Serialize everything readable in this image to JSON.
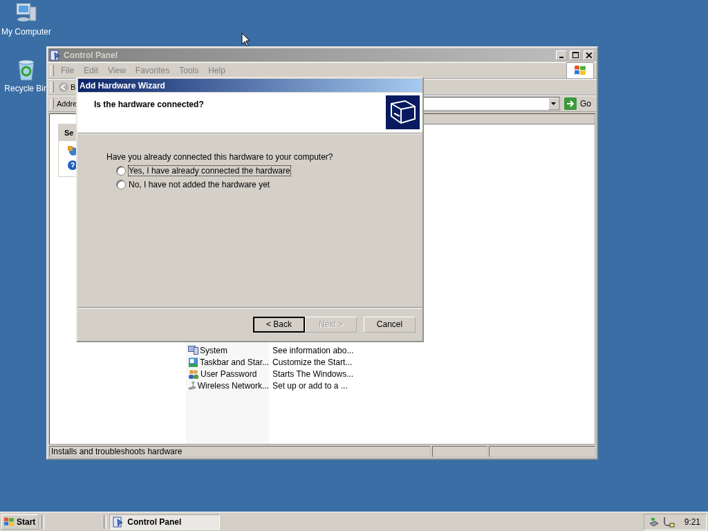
{
  "desktop_icons": [
    {
      "kind": "computer",
      "label": "My Computer"
    },
    {
      "kind": "recycle",
      "label": "Recycle Bin"
    }
  ],
  "window": {
    "title": "Control Panel",
    "active": false,
    "menu": [
      "File",
      "Edit",
      "View",
      "Favorites",
      "Tools",
      "Help"
    ],
    "toolbar": {
      "back_label": "B"
    },
    "address": {
      "label": "Addre",
      "go": "Go"
    },
    "see_also": {
      "title": "Se"
    },
    "list": [
      {
        "kind": "system",
        "name": "System",
        "comment": "See information abo..."
      },
      {
        "kind": "taskbar",
        "name": "Taskbar and Star...",
        "comment": "Customize the Start..."
      },
      {
        "kind": "users",
        "name": "User Password",
        "comment": "Starts The Windows..."
      },
      {
        "kind": "wireless",
        "name": "Wireless Network...",
        "comment": "Set up or add to a ..."
      }
    ],
    "status_bar": "Installs and troubleshoots hardware"
  },
  "dialog": {
    "title": "Add Hardware Wizard",
    "active": true,
    "heading": "Is the hardware connected?",
    "question": "Have you already connected this hardware to your computer?",
    "options": [
      {
        "label": "Yes, I have already connected the hardware",
        "selected": false,
        "focused": true
      },
      {
        "label": "No, I have not added the hardware yet",
        "selected": false,
        "focused": false
      }
    ],
    "buttons": [
      {
        "label": "< Back",
        "disabled": false,
        "default": true
      },
      {
        "label": "Next >",
        "disabled": true,
        "default": false
      },
      {
        "label": "Cancel",
        "disabled": false,
        "default": false
      }
    ]
  },
  "taskbar": {
    "start": "Start",
    "tasks": [
      {
        "label": "Control Panel",
        "pressed": true
      }
    ],
    "clock": "9:21"
  }
}
